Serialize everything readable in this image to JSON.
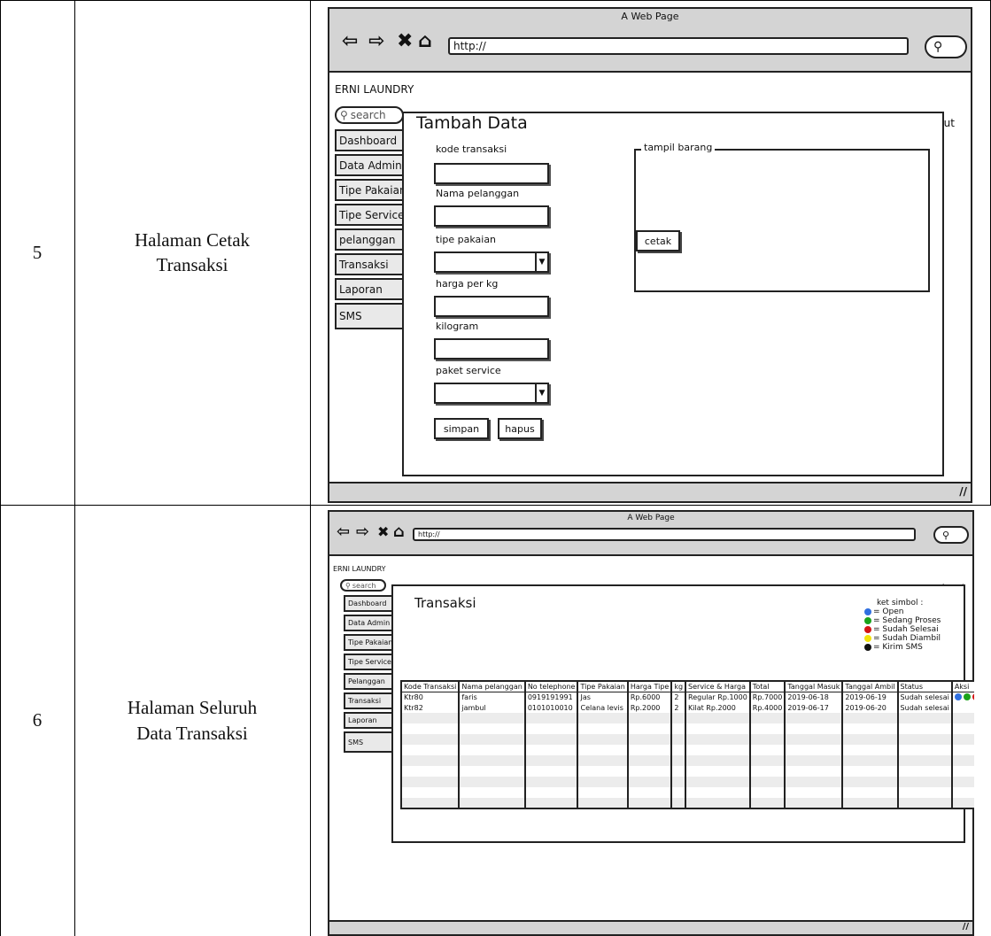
{
  "rows": [
    {
      "number": "5",
      "title_line1": "Halaman Cetak",
      "title_line2": "Transaksi"
    },
    {
      "number": "6",
      "title_line1": "Halaman Seluruh",
      "title_line2": "Data Transaksi"
    }
  ],
  "mockup_common": {
    "window_title": "A Web Page",
    "url": "http://",
    "brand": "ERNI LAUNDRY",
    "logout": "logout",
    "search_placeholder": "search"
  },
  "mockup1": {
    "sidebar": [
      "Dashboard",
      "Data Admin",
      "Tipe Pakaian",
      "Tipe Service",
      "pelanggan",
      "Transaksi",
      "Laporan",
      "SMS"
    ],
    "panel_title": "Tambah Data",
    "fields": {
      "kode": "kode transaksi",
      "nama": "Nama pelanggan",
      "tipe": "tipe pakaian",
      "harga": "harga per kg",
      "kilogram": "kilogram",
      "paket": "paket service"
    },
    "buttons": {
      "simpan": "simpan",
      "hapus": "hapus",
      "cetak": "cetak"
    },
    "group_label": "tampil barang"
  },
  "mockup2": {
    "sidebar": [
      "Dashboard",
      "Data Admin",
      "Tipe Pakaian",
      "Tipe Service",
      "Pelanggan",
      "Transaksi",
      "Laporan",
      "SMS"
    ],
    "panel_title": "Transaksi",
    "legend": {
      "title": "ket simbol :",
      "items": [
        {
          "label": "= Open",
          "color": "#2f6fe0"
        },
        {
          "label": "= Sedang Proses",
          "color": "#1aa31a"
        },
        {
          "label": "= Sudah Selesai",
          "color": "#d41414"
        },
        {
          "label": "= Sudah Diambil",
          "color": "#f2e20a"
        },
        {
          "label": "= Kirim SMS",
          "color": "#111111"
        }
      ]
    },
    "columns": [
      "Kode Transaksi",
      "Nama pelanggan",
      "No telephone",
      "Tipe Pakaian",
      "Harga Tipe",
      "kg",
      "Service & Harga",
      "Total",
      "Tanggal Masuk",
      "Tanggal Ambil",
      "Status",
      "Aksi"
    ],
    "data_rows": [
      [
        "Ktr80",
        "faris",
        "0919191991",
        "Jas",
        "Rp.6000",
        "2",
        "Regular Rp.1000",
        "Rp.7000",
        "2019-06-18",
        "2019-06-19",
        "Sudah selesai"
      ],
      [
        "Ktr82",
        "jambul",
        "0101010010",
        "Celana levis",
        "Rp.2000",
        "2",
        "Kilat Rp.2000",
        "Rp.4000",
        "2019-06-17",
        "2019-06-20",
        "Sudah selesai"
      ]
    ]
  }
}
